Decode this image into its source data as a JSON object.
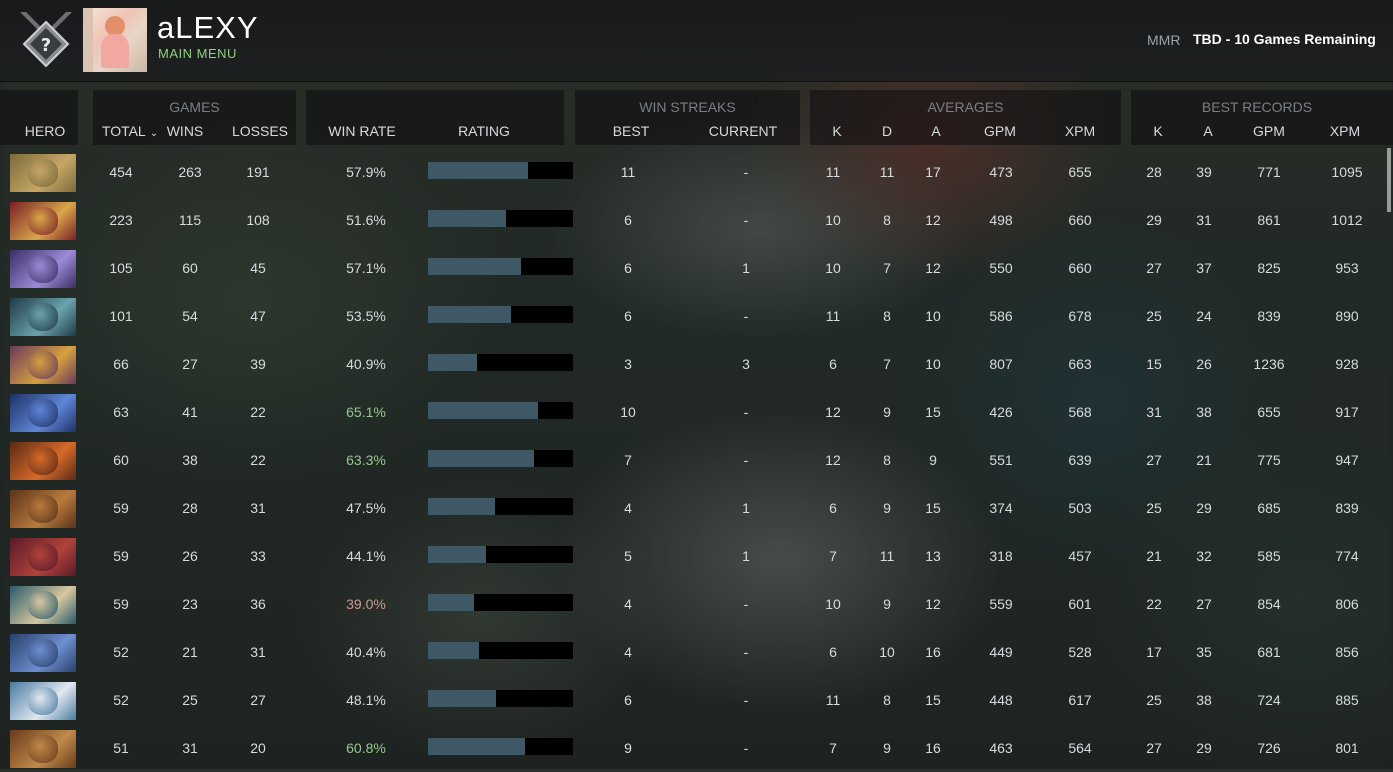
{
  "header": {
    "player_name": "aLEXY",
    "main_menu": "MAIN MENU",
    "mmr_label": "MMR",
    "mmr_value": "TBD - 10 Games Remaining"
  },
  "groups": {
    "games": "GAMES",
    "win_streaks": "WIN STREAKS",
    "averages": "AVERAGES",
    "best_records": "BEST RECORDS"
  },
  "columns": {
    "hero": "HERO",
    "total": "TOTAL",
    "wins": "WINS",
    "losses": "LOSSES",
    "win_rate": "WIN RATE",
    "rating": "RATING",
    "best": "BEST",
    "current": "CURRENT",
    "avg_k": "K",
    "avg_d": "D",
    "avg_a": "A",
    "avg_gpm": "GPM",
    "avg_xpm": "XPM",
    "best_k": "K",
    "best_a": "A",
    "best_gpm": "GPM",
    "best_xpm": "XPM"
  },
  "colors": {
    "win_high": "#93c98a",
    "win_low": "#c99b93",
    "rating_fill": "#3f5866",
    "accent_green": "#8fd17a"
  },
  "rows": [
    {
      "hero_icon": "hero-portrait-1",
      "total": "454",
      "wins": "263",
      "losses": "191",
      "win_rate": "57.9%",
      "rating": 0.69,
      "best": "11",
      "current": "-",
      "k": "11",
      "d": "11",
      "a": "17",
      "gpm": "473",
      "xpm": "655",
      "bk": "28",
      "ba": "39",
      "bgpm": "771",
      "bxpm": "1095",
      "tone": "neutral"
    },
    {
      "hero_icon": "hero-portrait-2",
      "total": "223",
      "wins": "115",
      "losses": "108",
      "win_rate": "51.6%",
      "rating": 0.54,
      "best": "6",
      "current": "-",
      "k": "10",
      "d": "8",
      "a": "12",
      "gpm": "498",
      "xpm": "660",
      "bk": "29",
      "ba": "31",
      "bgpm": "861",
      "bxpm": "1012",
      "tone": "neutral"
    },
    {
      "hero_icon": "hero-portrait-3",
      "total": "105",
      "wins": "60",
      "losses": "45",
      "win_rate": "57.1%",
      "rating": 0.64,
      "best": "6",
      "current": "1",
      "k": "10",
      "d": "7",
      "a": "12",
      "gpm": "550",
      "xpm": "660",
      "bk": "27",
      "ba": "37",
      "bgpm": "825",
      "bxpm": "953",
      "tone": "neutral"
    },
    {
      "hero_icon": "hero-portrait-4",
      "total": "101",
      "wins": "54",
      "losses": "47",
      "win_rate": "53.5%",
      "rating": 0.57,
      "best": "6",
      "current": "-",
      "k": "11",
      "d": "8",
      "a": "10",
      "gpm": "586",
      "xpm": "678",
      "bk": "25",
      "ba": "24",
      "bgpm": "839",
      "bxpm": "890",
      "tone": "neutral"
    },
    {
      "hero_icon": "hero-portrait-5",
      "total": "66",
      "wins": "27",
      "losses": "39",
      "win_rate": "40.9%",
      "rating": 0.34,
      "best": "3",
      "current": "3",
      "k": "6",
      "d": "7",
      "a": "10",
      "gpm": "807",
      "xpm": "663",
      "bk": "15",
      "ba": "26",
      "bgpm": "1236",
      "bxpm": "928",
      "tone": "neutral"
    },
    {
      "hero_icon": "hero-portrait-6",
      "total": "63",
      "wins": "41",
      "losses": "22",
      "win_rate": "65.1%",
      "rating": 0.76,
      "best": "10",
      "current": "-",
      "k": "12",
      "d": "9",
      "a": "15",
      "gpm": "426",
      "xpm": "568",
      "bk": "31",
      "ba": "38",
      "bgpm": "655",
      "bxpm": "917",
      "tone": "high"
    },
    {
      "hero_icon": "hero-portrait-7",
      "total": "60",
      "wins": "38",
      "losses": "22",
      "win_rate": "63.3%",
      "rating": 0.73,
      "best": "7",
      "current": "-",
      "k": "12",
      "d": "8",
      "a": "9",
      "gpm": "551",
      "xpm": "639",
      "bk": "27",
      "ba": "21",
      "bgpm": "775",
      "bxpm": "947",
      "tone": "high"
    },
    {
      "hero_icon": "hero-portrait-8",
      "total": "59",
      "wins": "28",
      "losses": "31",
      "win_rate": "47.5%",
      "rating": 0.46,
      "best": "4",
      "current": "1",
      "k": "6",
      "d": "9",
      "a": "15",
      "gpm": "374",
      "xpm": "503",
      "bk": "25",
      "ba": "29",
      "bgpm": "685",
      "bxpm": "839",
      "tone": "neutral"
    },
    {
      "hero_icon": "hero-portrait-9",
      "total": "59",
      "wins": "26",
      "losses": "33",
      "win_rate": "44.1%",
      "rating": 0.4,
      "best": "5",
      "current": "1",
      "k": "7",
      "d": "11",
      "a": "13",
      "gpm": "318",
      "xpm": "457",
      "bk": "21",
      "ba": "32",
      "bgpm": "585",
      "bxpm": "774",
      "tone": "neutral"
    },
    {
      "hero_icon": "hero-portrait-10",
      "total": "59",
      "wins": "23",
      "losses": "36",
      "win_rate": "39.0%",
      "rating": 0.32,
      "best": "4",
      "current": "-",
      "k": "10",
      "d": "9",
      "a": "12",
      "gpm": "559",
      "xpm": "601",
      "bk": "22",
      "ba": "27",
      "bgpm": "854",
      "bxpm": "806",
      "tone": "low"
    },
    {
      "hero_icon": "hero-portrait-11",
      "total": "52",
      "wins": "21",
      "losses": "31",
      "win_rate": "40.4%",
      "rating": 0.35,
      "best": "4",
      "current": "-",
      "k": "6",
      "d": "10",
      "a": "16",
      "gpm": "449",
      "xpm": "528",
      "bk": "17",
      "ba": "35",
      "bgpm": "681",
      "bxpm": "856",
      "tone": "neutral"
    },
    {
      "hero_icon": "hero-portrait-12",
      "total": "52",
      "wins": "25",
      "losses": "27",
      "win_rate": "48.1%",
      "rating": 0.47,
      "best": "6",
      "current": "-",
      "k": "11",
      "d": "8",
      "a": "15",
      "gpm": "448",
      "xpm": "617",
      "bk": "25",
      "ba": "38",
      "bgpm": "724",
      "bxpm": "885",
      "tone": "neutral"
    },
    {
      "hero_icon": "hero-portrait-13",
      "total": "51",
      "wins": "31",
      "losses": "20",
      "win_rate": "60.8%",
      "rating": 0.67,
      "best": "9",
      "current": "-",
      "k": "7",
      "d": "9",
      "a": "16",
      "gpm": "463",
      "xpm": "564",
      "bk": "27",
      "ba": "29",
      "bgpm": "726",
      "bxpm": "801",
      "tone": "high"
    }
  ]
}
